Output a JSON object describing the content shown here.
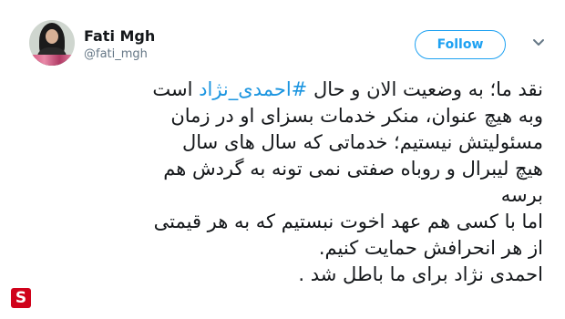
{
  "user": {
    "name": "Fati Mgh",
    "handle": "@fati_mgh"
  },
  "follow": {
    "label": "Follow"
  },
  "icons": {
    "chevron": "chevron-down-icon",
    "logo": "S"
  },
  "tweet": {
    "line1_prefix": "نقد ما؛ به وضعیت الان و حال ",
    "hashtag": "#احمدی_نژاد",
    "line1_suffix": " است",
    "line2": "وبه هیچ عنوان، منکر خدمات بسزای او در زمان",
    "line3": "مسئولیتش نیستیم؛ خدماتی که سال های سال",
    "line4": "هیچ لیبرال و روباه صفتی نمی تونه به گردش هم",
    "line5": "برسه",
    "line6": "اما با کسی هم عهد اخوت نبستیم که به هر قیمتی",
    "line7": "از هر انحرافش حمایت کنیم.",
    "line8": "احمدی نژاد برای ما باطل شد ."
  },
  "colors": {
    "accent": "#1da1f2",
    "hashtag": "#1b95e0",
    "logo_bg": "#d0021b"
  }
}
